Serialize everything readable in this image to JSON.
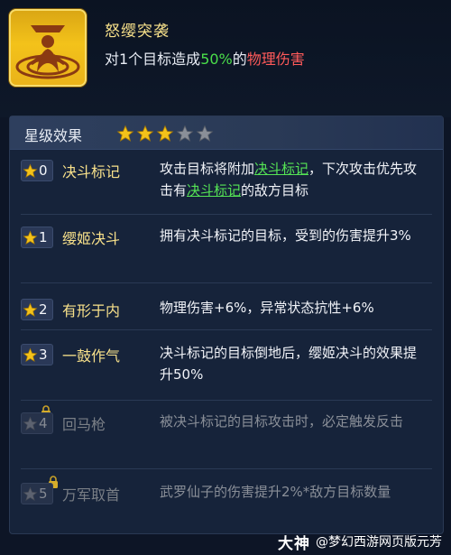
{
  "skill": {
    "icon": "warrior-emblem-icon",
    "title": "怒缨突袭",
    "desc_prefix": "对1个目标造成",
    "desc_pct": "50%",
    "desc_mid": "的",
    "desc_damage": "物理伤害"
  },
  "panel": {
    "title": "星级效果",
    "stars_total": 5,
    "stars_filled": 3,
    "rows": [
      {
        "num": "0",
        "name": "决斗标记",
        "locked": false,
        "text_a": "攻击目标将附加",
        "link_a": "决斗标记",
        "text_b": "，下次攻击优先攻击有",
        "link_b": "决斗标记",
        "text_c": "的敌方目标"
      },
      {
        "num": "1",
        "name": "缨姬决斗",
        "locked": false,
        "text": "拥有决斗标记的目标，受到的伤害提升3%"
      },
      {
        "num": "2",
        "name": "有形于内",
        "locked": false,
        "text": "物理伤害+6%，异常状态抗性+6%"
      },
      {
        "num": "3",
        "name": "一鼓作气",
        "locked": false,
        "text": "决斗标记的目标倒地后，缨姬决斗的效果提升50%"
      },
      {
        "num": "4",
        "name": "回马枪",
        "locked": true,
        "text": "被决斗标记的目标攻击时，必定触发反击"
      },
      {
        "num": "5",
        "name": "万军取首",
        "locked": true,
        "text": "武罗仙子的伤害提升2%*敌方目标数量"
      }
    ]
  },
  "watermark": {
    "logo": "大神",
    "text": "@梦幻西游网页版元芳"
  },
  "colors": {
    "gold_text": "#f7e08a",
    "green_text": "#4ade4a",
    "red_text": "#ff5a5a",
    "star_gold": "#f3c21a",
    "star_grey": "#8a8f98"
  }
}
